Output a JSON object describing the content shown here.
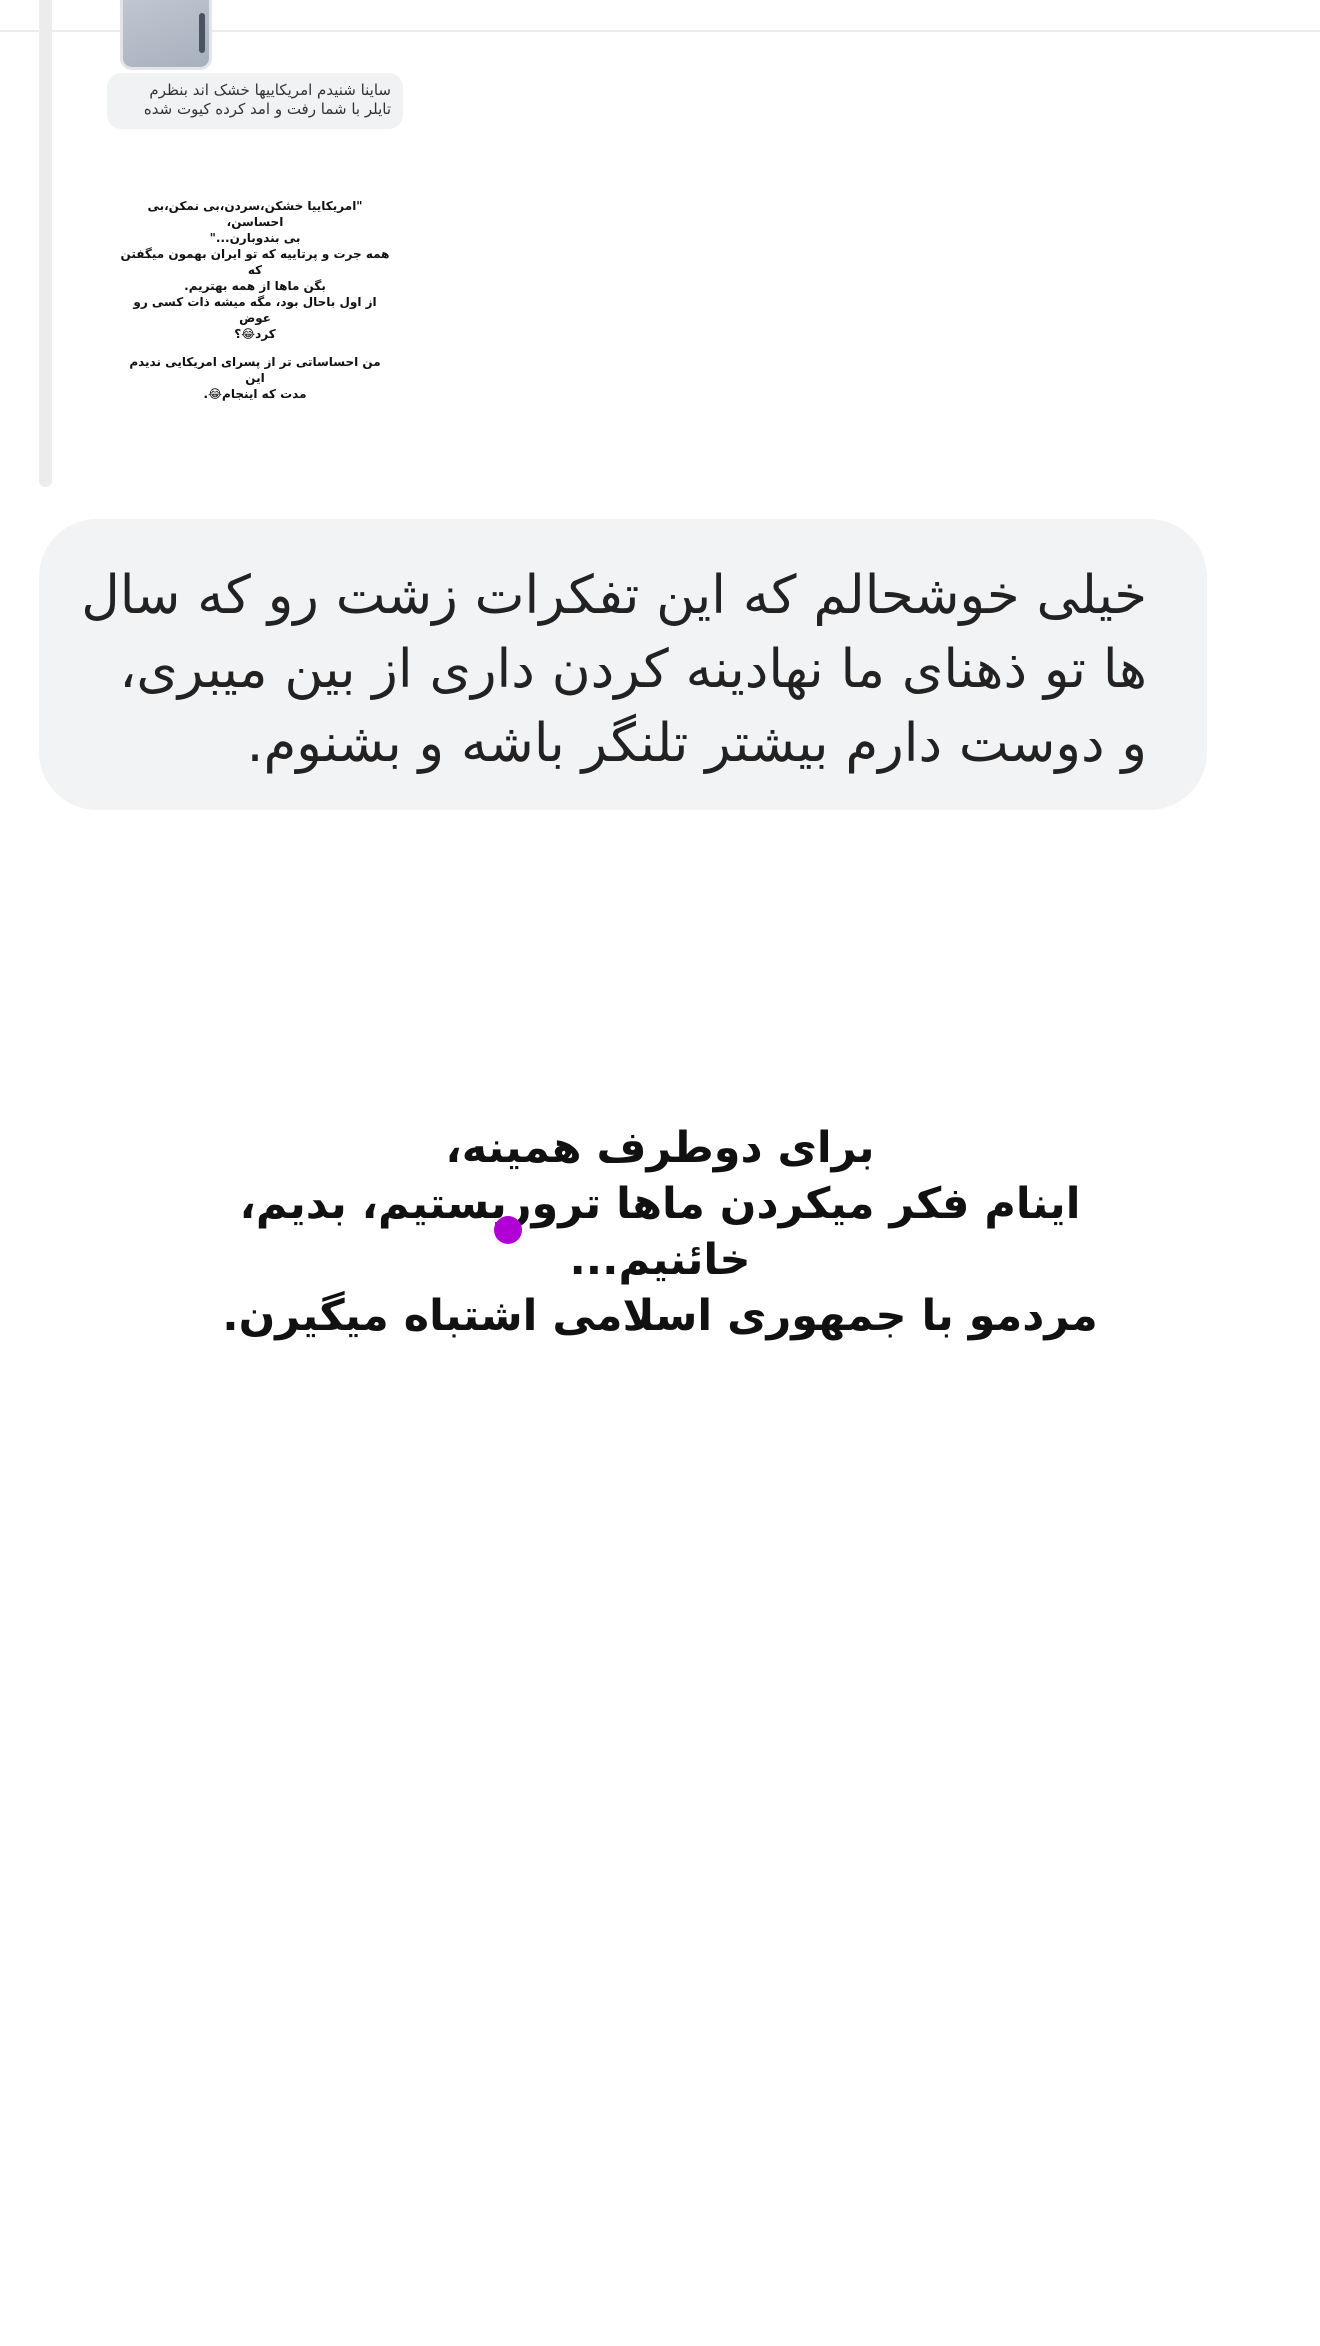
{
  "quoted_message": {
    "text": "ساینا شنیدم امریکاییها خشک اند بنظرم تایلر با شما رفت و امد کرده کیوت شده"
  },
  "quoted_card": {
    "lines": [
      "\"امریکاییا خشکن،سردن،بی نمکن،بی احساسن،",
      "بی بندوبارن...\"",
      "همه جرت و پرتاییه که تو ایران بهمون میگفتن که",
      "بگن ماها از همه بهتریم.",
      "از اول باحال بود، مگه میشه ذات کسی رو عوض",
      "کرد😂؟",
      "من احساساتی تر از پسرای امریکایی ندیدم این",
      "مدت که اینجام😂."
    ]
  },
  "message": {
    "text": "خیلی خوشحالم که این تفکرات زشت رو که سال ها تو ذهنای ما نهادینه کردن داری از بین میبری، و دوست دارم بیشتر تلنگر باشه و بشنوم."
  },
  "story_caption": {
    "lines": [
      "برای دوطرف همینه،",
      "اینام فکر میکردن ماها تروریستیم، بدیم،",
      "خائنیم...",
      "مردمو با جمهوری اسلامی اشتباه میگیرن."
    ]
  },
  "colors": {
    "bubble_bg": "#f2f3f5",
    "cursor_dot": "#b100d6"
  }
}
